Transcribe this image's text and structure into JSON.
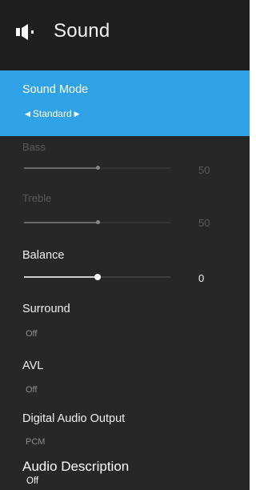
{
  "header": {
    "title": "Sound",
    "icon": "speaker-icon"
  },
  "colors": {
    "accent": "#2fa2e8",
    "background": "#272727"
  },
  "selected_item": {
    "label": "Sound Mode",
    "value": "Standard"
  },
  "sliders": {
    "bass": {
      "label": "Bass",
      "value": "50",
      "level": 0.5,
      "enabled": false
    },
    "treble": {
      "label": "Treble",
      "value": "50",
      "level": 0.5,
      "enabled": false
    },
    "balance": {
      "label": "Balance",
      "value": "0",
      "level": 0.5,
      "enabled": true
    }
  },
  "options": {
    "surround": {
      "label": "Surround",
      "value": "Off"
    },
    "avl": {
      "label": "AVL",
      "value": "Off"
    },
    "digital_audio_output": {
      "label": "Digital Audio Output",
      "value": "PCM"
    },
    "audio_description": {
      "label": "Audio Description",
      "value": "Off"
    }
  }
}
